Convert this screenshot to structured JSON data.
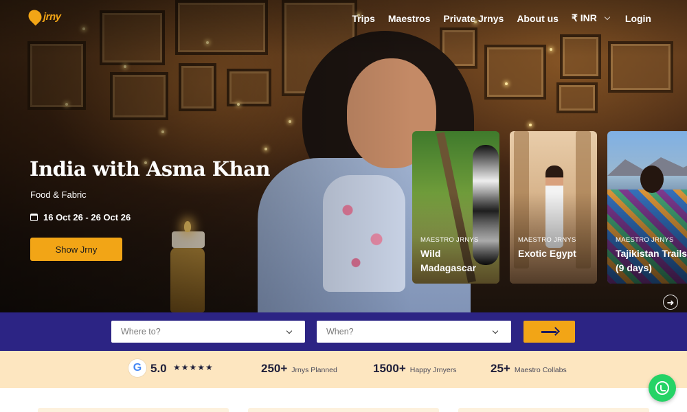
{
  "brand": {
    "logo_text": "jrny",
    "logo_icon": "jrny-logo-icon"
  },
  "nav": {
    "items": [
      "Trips",
      "Maestros",
      "Private Jrnys",
      "About us"
    ],
    "currency": "₹ INR",
    "login": "Login"
  },
  "hero": {
    "title": "India with Asma Khan",
    "subtitle": "Food & Fabric",
    "dates": "16 Oct 26 - 26 Oct 26",
    "cta": "Show Jrny"
  },
  "cards": [
    {
      "label": "MAESTRO JRNYS",
      "title": "Wild Madagascar"
    },
    {
      "label": "MAESTRO JRNYS",
      "title": "Exotic Egypt"
    },
    {
      "label": "MAESTRO JRNYS",
      "title": "Tajikistan Trails (9 days)"
    }
  ],
  "search": {
    "where_placeholder": "Where to?",
    "when_placeholder": "When?"
  },
  "stats": {
    "rating": "5.0",
    "stars": "★★★★★",
    "items": [
      {
        "value": "250+",
        "label": "Jrnys Planned"
      },
      {
        "value": "1500+",
        "label": "Happy Jrnyers"
      },
      {
        "value": "25+",
        "label": "Maestro Collabs"
      }
    ]
  },
  "colors": {
    "accent": "#f2a516",
    "search_band": "#2c2484",
    "stats_band": "#fde6c0",
    "whatsapp": "#25d366"
  }
}
